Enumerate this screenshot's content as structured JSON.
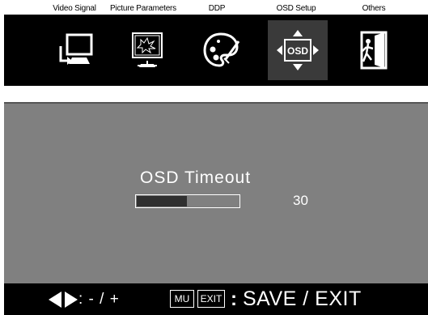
{
  "tabs": [
    {
      "label": "Video Signal",
      "icon": "video-signal-icon"
    },
    {
      "label": "Picture Parameters",
      "icon": "picture-parameters-icon"
    },
    {
      "label": "DDP",
      "icon": "palette-icon"
    },
    {
      "label": "OSD Setup",
      "icon": "osd-setup-icon",
      "selected": true
    },
    {
      "label": "Others",
      "icon": "exit-door-icon"
    }
  ],
  "setting": {
    "title": "OSD Timeout",
    "value": "30",
    "level_fraction": 0.5
  },
  "footer": {
    "adjust_text": ": - / +",
    "menu_key": "MU",
    "exit_key": "EXIT",
    "colon": ":",
    "save_exit": "SAVE / EXIT"
  },
  "colors": {
    "panel_bg": "#808080",
    "bar_fill": "#303030",
    "toolbar_bg": "#000000",
    "selected_bg": "#3a3a3a"
  }
}
